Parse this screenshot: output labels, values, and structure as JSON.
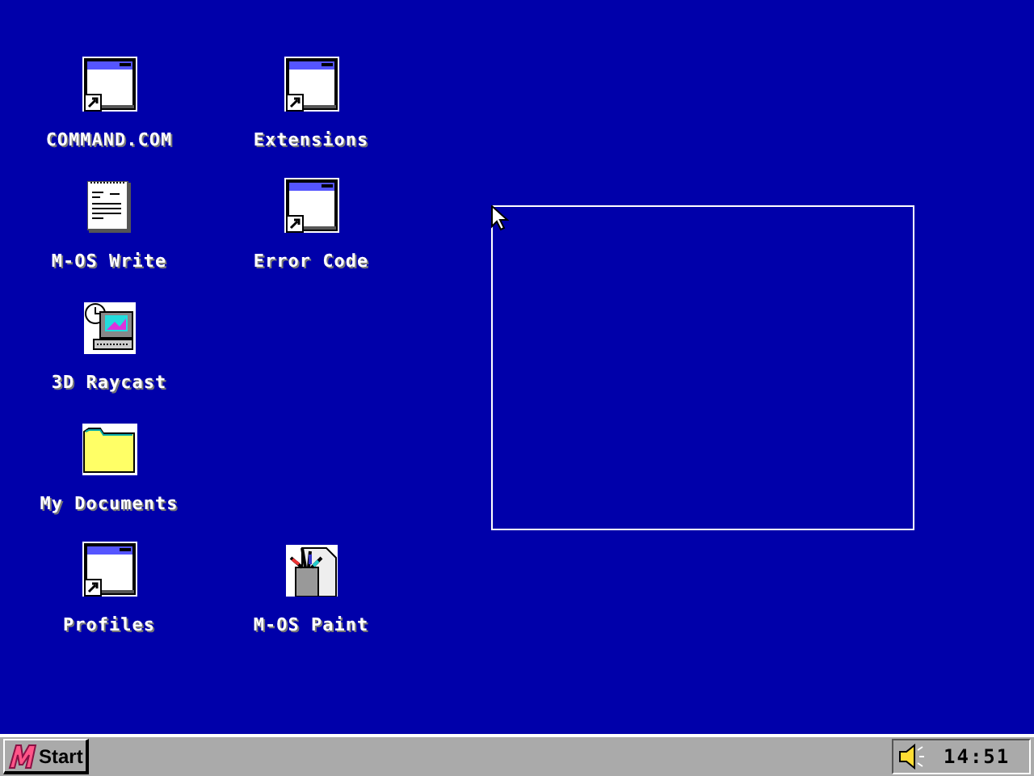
{
  "desktop": {
    "rows": [
      {
        "icons": [
          {
            "label": "COMMAND.COM",
            "kind": "shortcut"
          },
          {
            "label": "Extensions",
            "kind": "shortcut"
          }
        ]
      },
      {
        "icons": [
          {
            "label": "M-OS Write",
            "kind": "notepad"
          },
          {
            "label": "Error Code",
            "kind": "shortcut"
          }
        ]
      },
      {
        "icons": [
          {
            "label": "3D Raycast",
            "kind": "computer"
          }
        ]
      },
      {
        "icons": [
          {
            "label": "My Documents",
            "kind": "folder"
          }
        ]
      },
      {
        "icons": [
          {
            "label": "Profiles",
            "kind": "shortcut"
          },
          {
            "label": "M-OS Paint",
            "kind": "paint"
          }
        ]
      }
    ],
    "selection_marquee": true,
    "mouse_pointer": true
  },
  "taskbar": {
    "start_label": "Start",
    "clock": "14:51"
  }
}
